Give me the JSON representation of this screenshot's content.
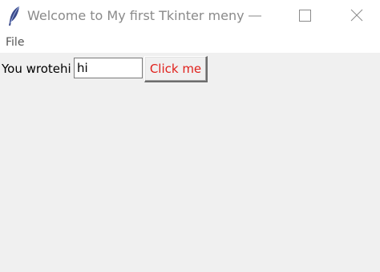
{
  "window": {
    "title": "Welcome to My first Tkinter meny",
    "icon": "feather-icon",
    "controls": [
      "minimize-icon",
      "maximize-icon",
      "close-icon"
    ]
  },
  "menubar": {
    "items": [
      {
        "label": "File"
      }
    ]
  },
  "form": {
    "label": "You wrotehi",
    "entry_value": "hi",
    "button_label": "Click me"
  },
  "colors": {
    "title_text": "#8a8a8a",
    "client_background": "#f0f0f0",
    "button_text": "#e0201b"
  }
}
